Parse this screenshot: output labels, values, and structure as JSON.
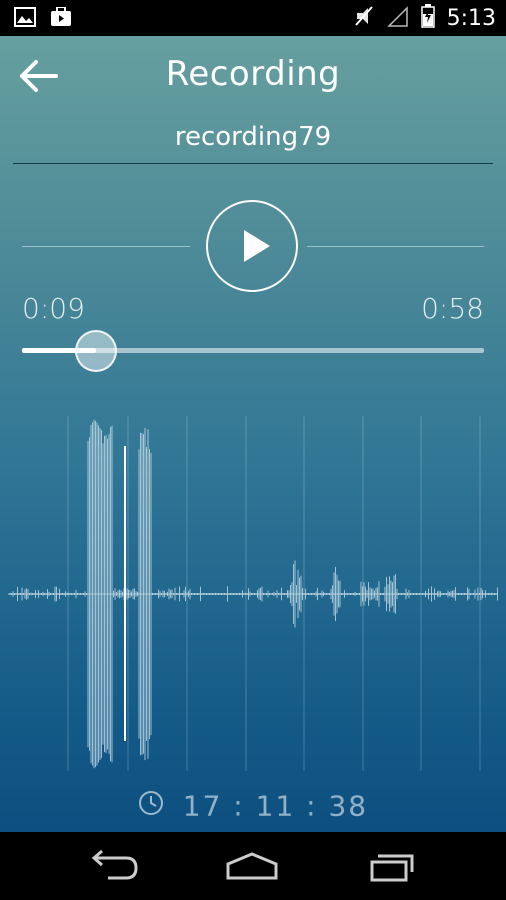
{
  "status_bar": {
    "time": "5:13",
    "icons": [
      "image-icon",
      "briefcase-icon",
      "muted-icon",
      "signal-icon",
      "battery-icon"
    ]
  },
  "header": {
    "title": "Recording",
    "back_icon": "arrow-left-icon"
  },
  "recording": {
    "name": "recording79"
  },
  "player": {
    "play_icon": "play-icon",
    "elapsed": "0:09",
    "total": "0:58",
    "progress": 0.16
  },
  "timestamp": {
    "icon": "clock-icon",
    "value": "17 : 11 : 38"
  },
  "nav": {
    "icons": [
      "back-icon",
      "home-icon",
      "recent-apps-icon"
    ]
  },
  "colors": {
    "gradient_top": "#669f9f",
    "gradient_bottom": "#0d4f80",
    "accent": "#ffffff"
  }
}
